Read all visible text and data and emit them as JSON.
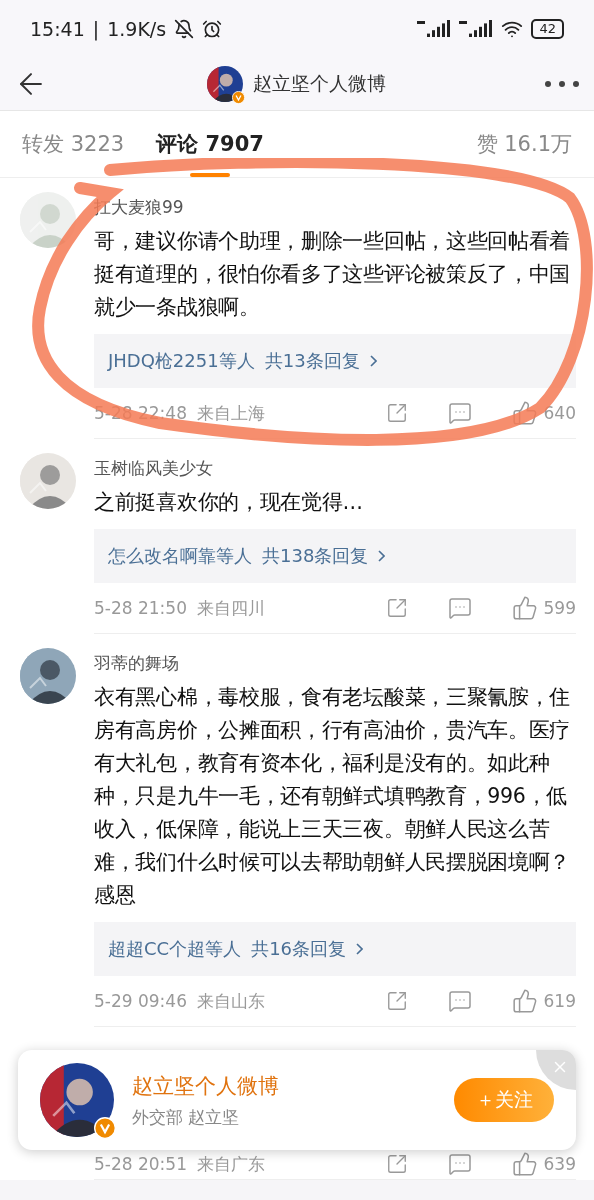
{
  "status_bar": {
    "time": "15:41",
    "separator": "|",
    "speed": "1.9K/s",
    "battery": "42"
  },
  "header": {
    "title": "赵立坚个人微博"
  },
  "tabs": [
    {
      "label": "转发 3223",
      "selected": false
    },
    {
      "label": "评论 7907",
      "selected": true
    },
    {
      "label": "赞 16.1万",
      "selected": false
    }
  ],
  "comments": [
    {
      "user": "扛大麦狼99",
      "text": "哥，建议你请个助理，删除一些回帖，这些回帖看着挺有道理的，很怕你看多了这些评论被策反了，中国就少一条战狼啊。",
      "reply_names": "JHDQ枪2251等人",
      "reply_count": "共13条回复",
      "time": "5-28 22:48",
      "location": "来自上海",
      "likes": "640",
      "highlighted": true
    },
    {
      "user": "玉树临风美少女",
      "text": "之前挺喜欢你的，现在觉得…",
      "reply_names": "怎么改名啊靠等人",
      "reply_count": "共138条回复",
      "time": "5-28 21:50",
      "location": "来自四川",
      "likes": "599",
      "highlighted": false
    },
    {
      "user": "羽蒂的舞场",
      "text": "衣有黑心棉，毒校服，食有老坛酸菜，三聚氰胺，住房有高房价，公摊面积，行有高油价，贵汽车。医疗有大礼包，教育有资本化，福利是没有的。如此种种，只是九牛一毛，还有朝鲜式填鸭教育，996，低收入，低保障，能说上三天三夜。朝鲜人民这么苦难，我们什么时候可以去帮助朝鲜人民摆脱困境啊？感恩",
      "reply_names": "超超CC个超等人",
      "reply_count": "共16条回复",
      "time": "5-29 09:46",
      "location": "来自山东",
      "likes": "619",
      "highlighted": false
    }
  ],
  "partial_comment": {
    "time": "5-28 20:51",
    "location": "来自广东",
    "likes": "639"
  },
  "follow_banner": {
    "name": "赵立坚个人微博",
    "subtitle": "外交部 赵立坚",
    "button": "＋关注"
  }
}
